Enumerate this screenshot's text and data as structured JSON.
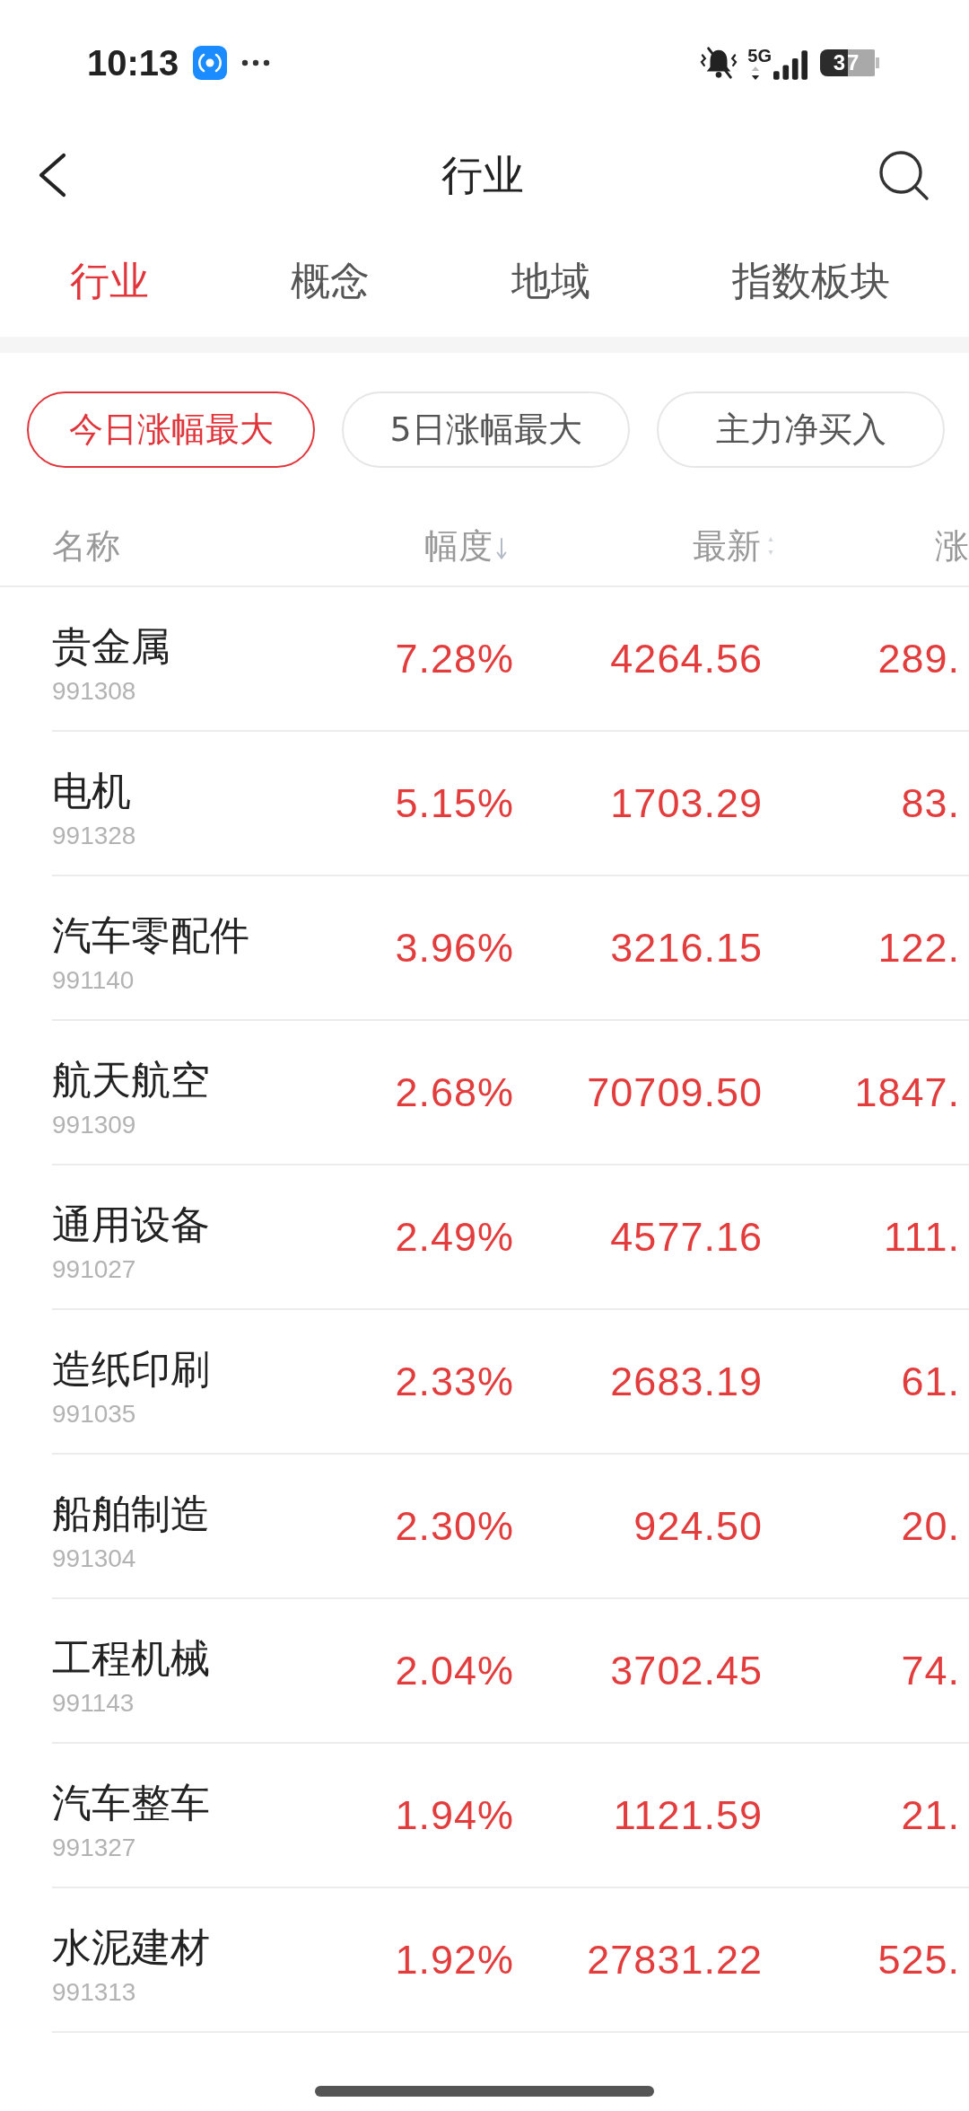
{
  "status_bar": {
    "time": "10:13",
    "network": "5G",
    "battery": "37"
  },
  "header": {
    "title": "行业"
  },
  "tabs": [
    {
      "label": "行业",
      "selected": true
    },
    {
      "label": "概念",
      "selected": false
    },
    {
      "label": "地域",
      "selected": false
    },
    {
      "label": "指数板块",
      "selected": false
    }
  ],
  "filters": [
    {
      "label": "今日涨幅最大",
      "selected": true
    },
    {
      "label": "5日涨幅最大",
      "selected": false
    },
    {
      "label": "主力净买入",
      "selected": false
    }
  ],
  "table": {
    "columns": [
      {
        "label": "名称",
        "sortable": false,
        "sorted": false
      },
      {
        "label": "幅度",
        "sortable": true,
        "sorted": true
      },
      {
        "label": "最新",
        "sortable": true,
        "sorted": false
      },
      {
        "label": "涨",
        "sortable": false,
        "sorted": false
      }
    ],
    "rows": [
      {
        "name": "贵金属",
        "code": "991308",
        "change_pct": "7.28%",
        "latest": "4264.56",
        "column_4": "289.",
        "rising": true
      },
      {
        "name": "电机",
        "code": "991328",
        "change_pct": "5.15%",
        "latest": "1703.29",
        "column_4": "83.",
        "rising": true
      },
      {
        "name": "汽车零配件",
        "code": "991140",
        "change_pct": "3.96%",
        "latest": "3216.15",
        "column_4": "122.",
        "rising": true
      },
      {
        "name": "航天航空",
        "code": "991309",
        "change_pct": "2.68%",
        "latest": "70709.50",
        "column_4": "1847.",
        "rising": true
      },
      {
        "name": "通用设备",
        "code": "991027",
        "change_pct": "2.49%",
        "latest": "4577.16",
        "column_4": "111.",
        "rising": true
      },
      {
        "name": "造纸印刷",
        "code": "991035",
        "change_pct": "2.33%",
        "latest": "2683.19",
        "column_4": "61.",
        "rising": true
      },
      {
        "name": "船舶制造",
        "code": "991304",
        "change_pct": "2.30%",
        "latest": "924.50",
        "column_4": "20.",
        "rising": true
      },
      {
        "name": "工程机械",
        "code": "991143",
        "change_pct": "2.04%",
        "latest": "3702.45",
        "column_4": "74.",
        "rising": true
      },
      {
        "name": "汽车整车",
        "code": "991327",
        "change_pct": "1.94%",
        "latest": "1121.59",
        "column_4": "21.",
        "rising": true
      },
      {
        "name": "水泥建材",
        "code": "991313",
        "change_pct": "1.92%",
        "latest": "27831.22",
        "column_4": "525.",
        "rising": true
      }
    ]
  }
}
